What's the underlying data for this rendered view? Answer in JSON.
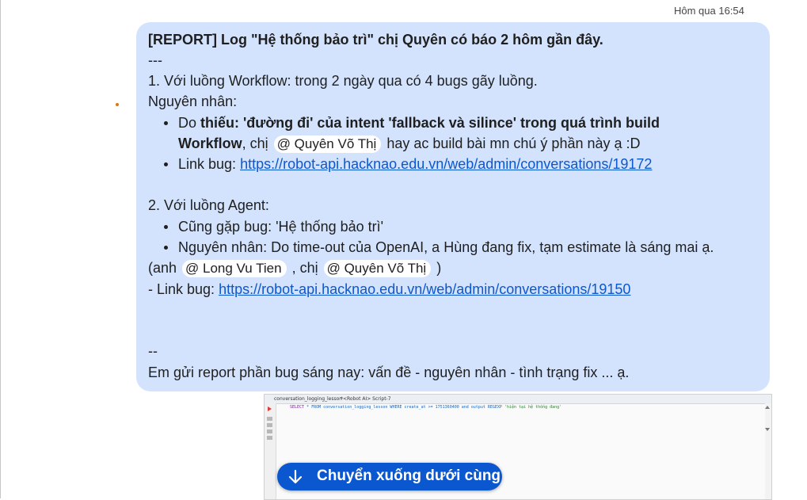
{
  "timestamp": "Hôm qua 16:54",
  "message": {
    "title": "[REPORT] Log \"Hệ thống bảo trì\" chị Quyên có báo 2 hôm gần đây.",
    "separator": "---",
    "workflow_heading": "1. Với luồng Workflow: trong 2 ngày qua có 4 bugs gãy luồng.",
    "cause_label": "Nguyên nhân:",
    "wf_bullet1": {
      "prefix": "Do ",
      "bold_part1": "thiếu: 'đường đi' của intent 'fallback và silince' trong quá trình build",
      "bold_part2": "Workflow",
      "mid": ", chị ",
      "mention": "Quyên Võ Thị",
      "suffix": " hay ac build bài mn chú ý phần này ạ :D"
    },
    "wf_bullet2": {
      "prefix": "Link bug: ",
      "link": "https://robot-api.hacknao.edu.vn/web/admin/conversations/19172"
    },
    "agent_heading": "2. Với luồng Agent:",
    "agent_bullet1": "Cũng gặp bug: 'Hệ thống bảo trì'",
    "agent_bullet2": "Nguyên nhân: Do time-out của OpenAI, a Hùng đang fix, tạm estimate là sáng mai ạ.",
    "agent_line3": {
      "prefix": "(anh ",
      "mention1": "Long Vu Tien",
      "mid": " , chị ",
      "mention2": "Quyên Võ Thị",
      "suffix": " )"
    },
    "agent_link_line": {
      "prefix": "- Link bug: ",
      "link": "https://robot-api.hacknao.edu.vn/web/admin/conversations/19150"
    },
    "end_separator": "--",
    "closing": "Em gửi report phần bug sáng nay: vấn đề - nguyên nhân - tình trạng fix ... ạ."
  },
  "attachment": {
    "tab1": "conversation_logging_lesson",
    "tab2": "*<Robot AI> Script-7",
    "sql_kw1": "SELECT",
    "sql_mid": " * FROM conversation_logging_lesson WHERE create_at >= 1751360400 and output REGEXP ",
    "sql_str": "'hiện tại hệ thống đang'"
  },
  "jump_button": {
    "label": "Chuyển xuống dưới cùng",
    "icon": "arrow-down-icon"
  },
  "colors": {
    "bubble": "#d3e3fd",
    "link": "#0b57d0",
    "button": "#0b57d0"
  }
}
